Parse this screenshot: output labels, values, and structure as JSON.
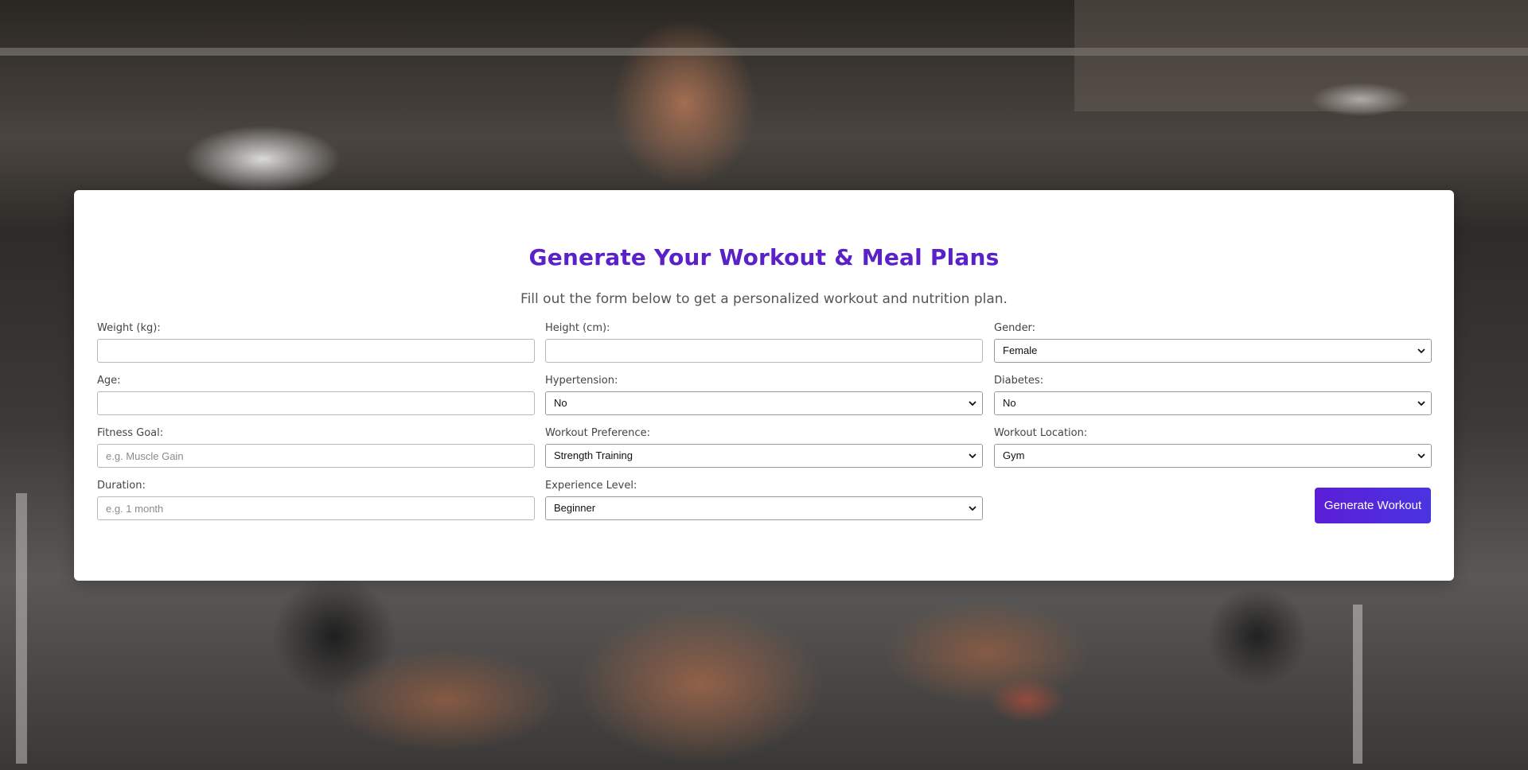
{
  "page": {
    "title": "Generate Your Workout & Meal Plans",
    "subtitle": "Fill out the form below to get a personalized workout and nutrition plan."
  },
  "form": {
    "weight": {
      "label": "Weight (kg):",
      "value": "",
      "placeholder": ""
    },
    "height": {
      "label": "Height (cm):",
      "value": "",
      "placeholder": ""
    },
    "gender": {
      "label": "Gender:",
      "selected": "Female"
    },
    "age": {
      "label": "Age:",
      "value": "",
      "placeholder": ""
    },
    "hypertension": {
      "label": "Hypertension:",
      "selected": "No"
    },
    "diabetes": {
      "label": "Diabetes:",
      "selected": "No"
    },
    "fitness_goal": {
      "label": "Fitness Goal:",
      "value": "",
      "placeholder": "e.g. Muscle Gain"
    },
    "workout_preference": {
      "label": "Workout Preference:",
      "selected": "Strength Training"
    },
    "workout_location": {
      "label": "Workout Location:",
      "selected": "Gym"
    },
    "duration": {
      "label": "Duration:",
      "value": "",
      "placeholder": "e.g. 1 month"
    },
    "experience_level": {
      "label": "Experience Level:",
      "selected": "Beginner"
    },
    "submit_label": "Generate Workout"
  },
  "colors": {
    "title": "#5b21c9",
    "button_start": "#5b1ed6",
    "button_end": "#4a35e0",
    "card": "#ffffff"
  },
  "icons": {
    "select_arrow": "chevron-down-icon"
  }
}
